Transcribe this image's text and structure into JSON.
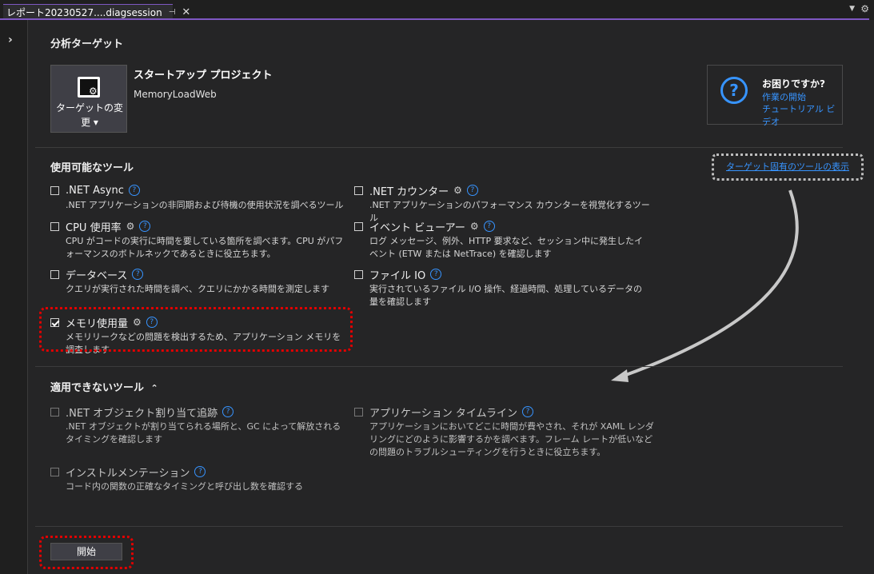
{
  "tab": {
    "title": "レポート20230527....diagsession",
    "pin_icon": "pin-icon",
    "close_icon": "close-icon"
  },
  "sidebar": {
    "expander_icon": "chevron-right-icon"
  },
  "analysis_target": {
    "heading": "分析ターゲット",
    "change_target_label": "ターゲットの変更 ▾",
    "project_title": "スタートアップ プロジェクト",
    "project_name": "MemoryLoadWeb"
  },
  "help": {
    "title": "お困りですか?",
    "link_start": "作業の開始",
    "link_video": "チュートリアル ビデオ"
  },
  "available_tools": {
    "heading": "使用可能なツール",
    "show_target_specific": "ターゲット固有のツールの表示",
    "items": [
      {
        "name": ".NET Async",
        "desc": ".NET アプリケーションの非同期および待機の使用状況を調べるツール",
        "checked": false,
        "gear": false
      },
      {
        "name": ".NET カウンター",
        "desc": ".NET アプリケーションのパフォーマンス カウンターを視覚化するツール",
        "checked": false,
        "gear": true
      },
      {
        "name": "CPU 使用率",
        "desc": "CPU がコードの実行に時間を要している箇所を調べます。CPU がパフォーマンスのボトルネックであるときに役立ちます。",
        "checked": false,
        "gear": true
      },
      {
        "name": "イベント ビューアー",
        "desc": "ログ メッセージ、例外、HTTP 要求など、セッション中に発生したイベント (ETW または NetTrace) を確認します",
        "checked": false,
        "gear": true
      },
      {
        "name": "データベース",
        "desc": "クエリが実行された時間を調べ、クエリにかかる時間を測定します",
        "checked": false,
        "gear": false
      },
      {
        "name": "ファイル IO",
        "desc": "実行されているファイル I/O 操作、経過時間、処理しているデータの量を確認します",
        "checked": false,
        "gear": false
      },
      {
        "name": "メモリ使用量",
        "desc": "メモリリークなどの問題を検出するため、アプリケーション メモリを調査します",
        "checked": true,
        "gear": true
      }
    ]
  },
  "unavailable_tools": {
    "heading": "適用できないツール",
    "collapse_icon": "chevron-up-icon",
    "items": [
      {
        "name": ".NET オブジェクト割り当て追跡",
        "desc": ".NET オブジェクトが割り当てられる場所と、GC によって解放されるタイミングを確認します"
      },
      {
        "name": "アプリケーション タイムライン",
        "desc": "アプリケーションにおいてどこに時間が費やされ、それが XAML レンダリングにどのように影響するかを調べます。フレーム レートが低いなどの問題のトラブルシューティングを行うときに役立ちます。"
      },
      {
        "name": "インストルメンテーション",
        "desc": "コード内の関数の正確なタイミングと呼び出し数を確認する"
      }
    ]
  },
  "start_button": "開始",
  "colors": {
    "accent": "#7e57c2",
    "link": "#3794ff",
    "highlight": "#e00000"
  }
}
